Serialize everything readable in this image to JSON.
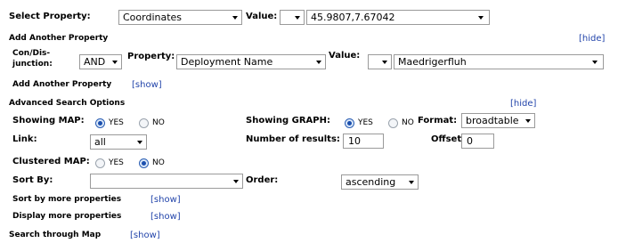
{
  "row1": {
    "select_property_label": "Select Property:",
    "property_value": "Coordinates",
    "value_label": "Value:",
    "comparator": "",
    "value": "45.9807,7.67042"
  },
  "add_another_property_heading": "Add Another Property",
  "hide_label": "[hide]",
  "row2": {
    "conj_label_line1": "Con/Dis-",
    "conj_label_line2": "junction:",
    "conj_value": "AND",
    "property_label": "Property:",
    "property_value": "Deployment Name",
    "value_label": "Value:",
    "comparator": "",
    "value": "Maedrigerfluh"
  },
  "add_another_property_link_label": "Add Another Property",
  "show_label": "[show]",
  "advanced": {
    "heading": "Advanced Search Options",
    "hide_label": "[hide]",
    "showing_map_label": "Showing MAP:",
    "map_yes": "YES",
    "map_no": "NO",
    "map_selected": "yes",
    "showing_graph_label": "Showing GRAPH:",
    "graph_yes": "YES",
    "graph_no": "NO",
    "graph_selected": "yes",
    "format_label": "Format:",
    "format_value": "broadtable",
    "link_label": "Link:",
    "link_value": "all",
    "num_results_label": "Number of results:",
    "num_results_value": "10",
    "offset_label": "Offset:",
    "offset_value": "0",
    "clustered_map_label": "Clustered MAP:",
    "clustered_yes": "YES",
    "clustered_no": "NO",
    "clustered_selected": "no",
    "sort_by_label": "Sort By:",
    "sort_by_value": "",
    "order_label": "Order:",
    "order_value": "ascending",
    "sort_more_label": "Sort by more properties",
    "sort_more_show": "[show]",
    "display_more_label": "Display more properties",
    "display_more_show": "[show]",
    "search_map_label": "Search through Map",
    "search_map_show": "[show]"
  }
}
